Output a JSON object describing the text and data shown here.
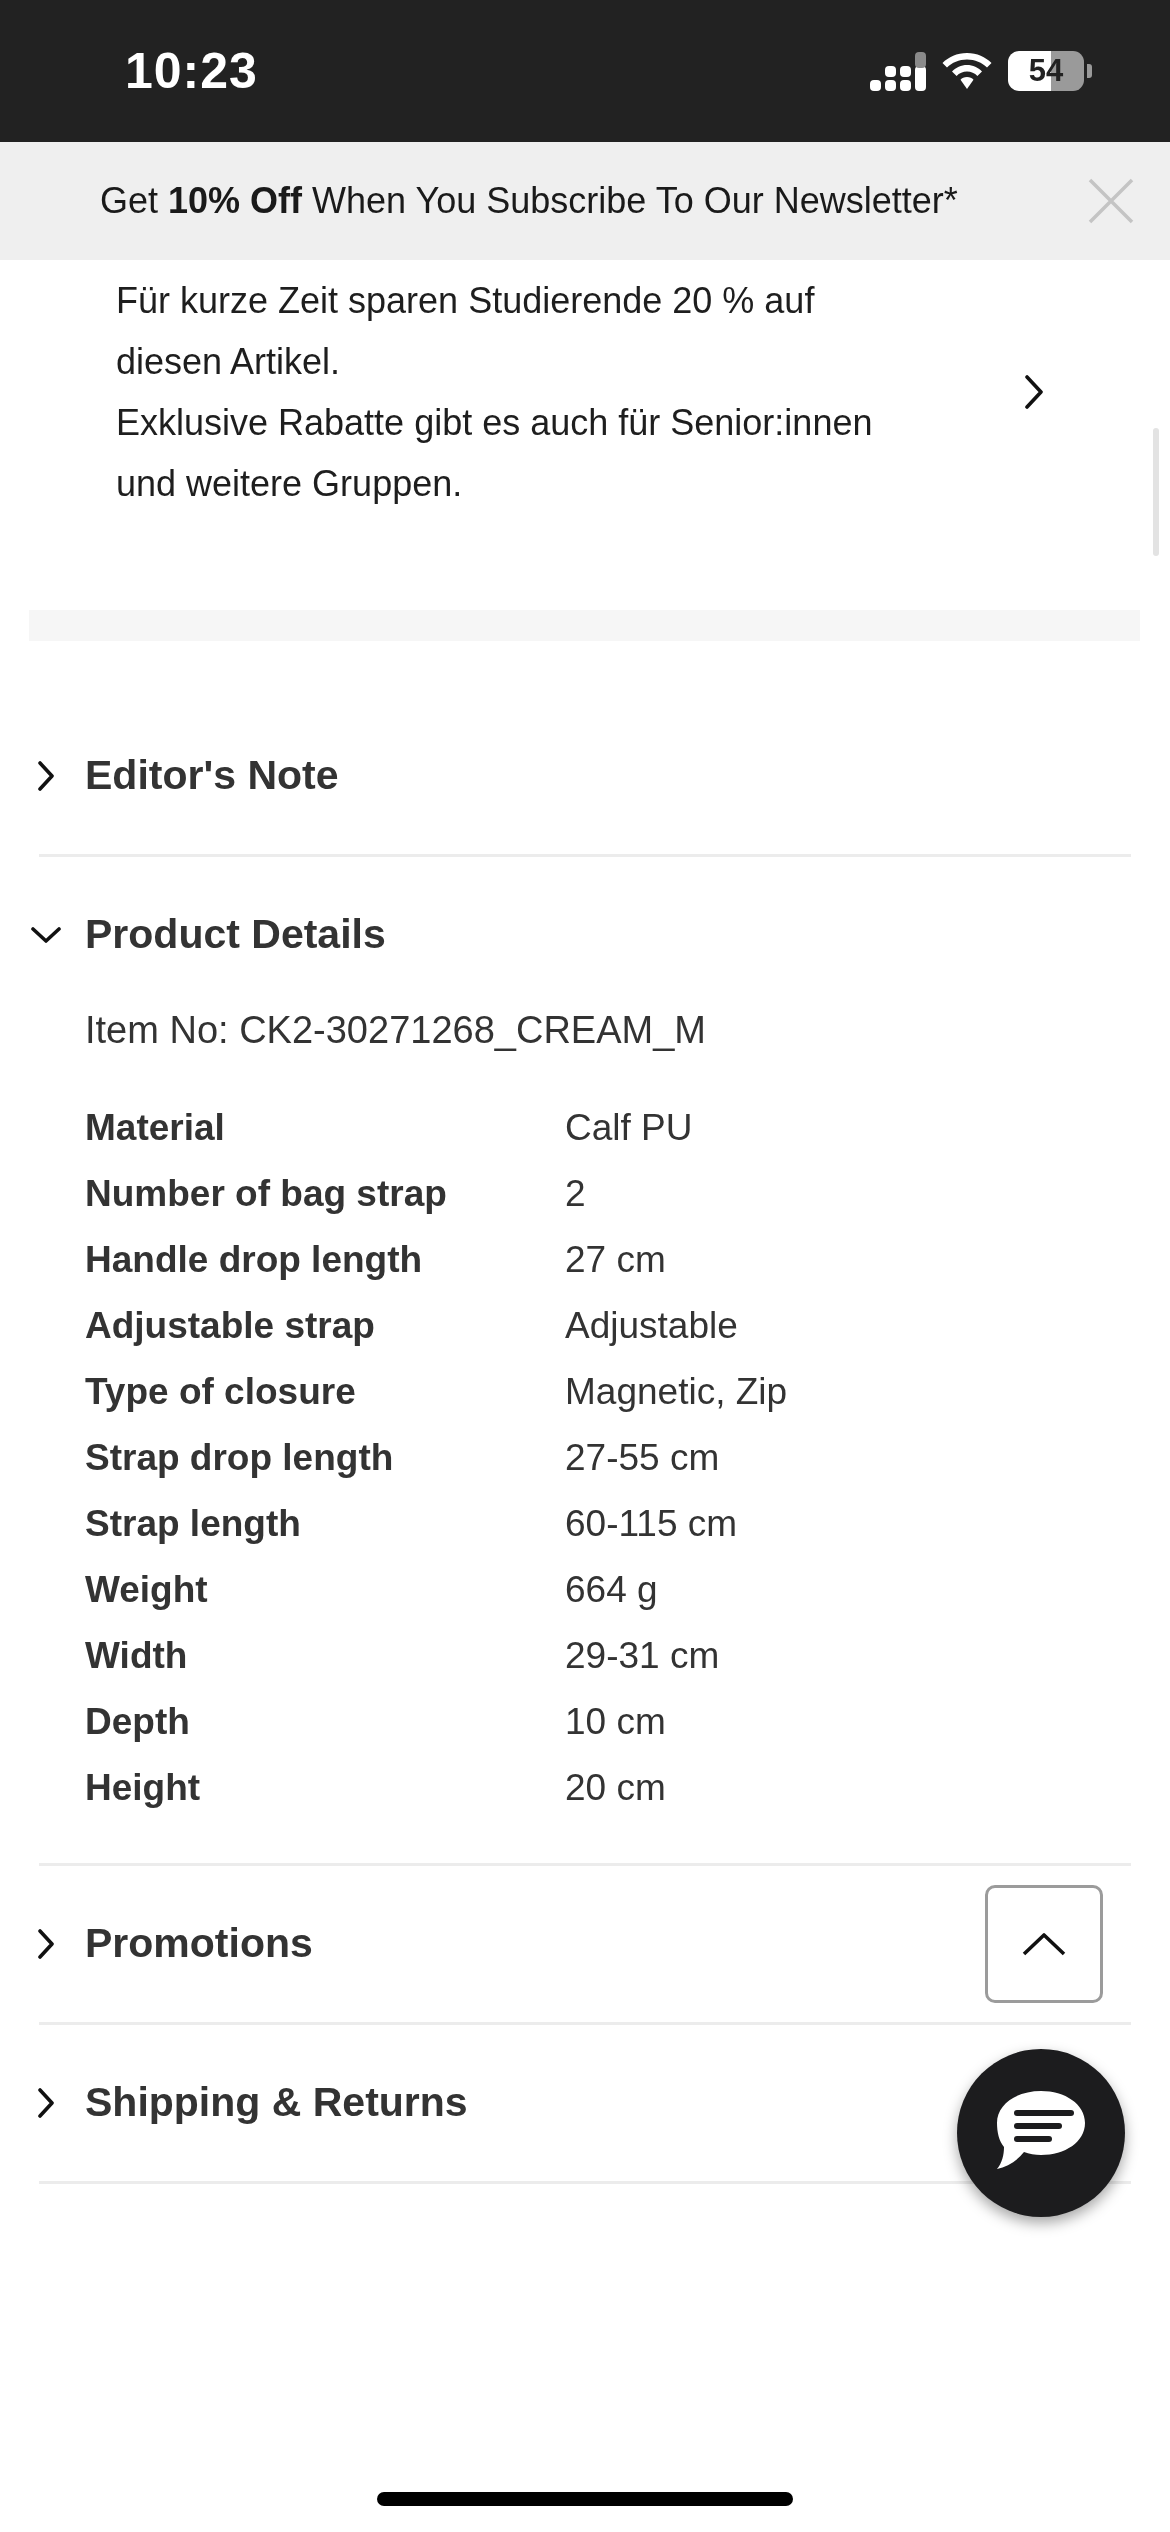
{
  "status_bar": {
    "time": "10:23",
    "battery": "54"
  },
  "banner": {
    "text": "Get **10% Off** When You Subscribe To Our Newsletter*"
  },
  "discount_note": {
    "paragraphs": [
      "Für kurze Zeit sparen Studierende 20 % auf diesen Artikel.",
      "Exklusive Rabatte gibt es auch für Senior:innen und weitere Gruppen."
    ]
  },
  "sections": [
    {
      "title": "Editor's Note",
      "expanded": false
    },
    {
      "title": "Product Details",
      "expanded": true,
      "item_no": "Item No: CK2-30271268_CREAM_M",
      "specs": [
        {
          "label": "Material",
          "value": "Calf PU"
        },
        {
          "label": "Number of bag strap",
          "value": "2"
        },
        {
          "label": "Handle drop length",
          "value": "27 cm"
        },
        {
          "label": "Adjustable strap",
          "value": "Adjustable"
        },
        {
          "label": "Type of closure",
          "value": "Magnetic, Zip"
        },
        {
          "label": "Strap drop length",
          "value": "27-55 cm"
        },
        {
          "label": "Strap length",
          "value": "60-115 cm"
        },
        {
          "label": "Weight",
          "value": "664 g"
        },
        {
          "label": "Width",
          "value": "29-31 cm"
        },
        {
          "label": "Depth",
          "value": "10 cm"
        },
        {
          "label": "Height",
          "value": "20 cm"
        }
      ]
    },
    {
      "title": "Promotions",
      "expanded": false
    },
    {
      "title": "Shipping & Returns",
      "expanded": false
    }
  ]
}
